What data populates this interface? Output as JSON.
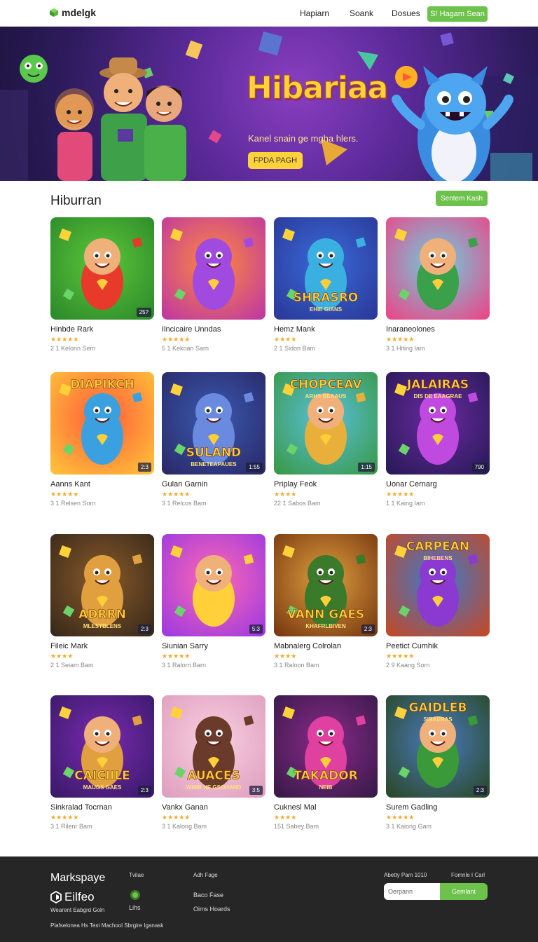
{
  "header": {
    "logo_text": "mdelgk",
    "nav": [
      "Hapiarn",
      "Soank",
      "Dosues"
    ],
    "cta": "S! Hagam Sean"
  },
  "hero": {
    "title": "Hibariaa",
    "subtitle": "Kanel snain ge mgha hlers.",
    "button": "FPDA PAGH"
  },
  "section": {
    "title": "Hiburran",
    "button": "Sentem Kash"
  },
  "cards": [
    {
      "title": "Hinbde Rark",
      "stars": "★★★★★",
      "meta": "2 1 Kelonn Sern",
      "badge": "25?",
      "caption": "",
      "caption_sub": ""
    },
    {
      "title": "Ilncicaire Unndas",
      "stars": "★★★★★",
      "meta": "5 1 Kekoan Sarn",
      "badge": "",
      "caption": "",
      "caption_sub": ""
    },
    {
      "title": "Hemz Mank",
      "stars": "★★★★",
      "meta": "2 1 Sidon Bam",
      "badge": "",
      "caption": "SHRASRO",
      "caption_sub": "EHIE GIANS"
    },
    {
      "title": "Inaraneolones",
      "stars": "★★★★★",
      "meta": "3 1 Hiting Iam",
      "badge": "",
      "caption": "",
      "caption_sub": ""
    },
    {
      "title": "Aanns Kant",
      "stars": "★★★★★",
      "meta": "3 1 Relsen Sorn",
      "badge": "2:3",
      "caption": "DIAPIKCH",
      "caption_sub": ""
    },
    {
      "title": "Gulan Garnin",
      "stars": "★★★★★",
      "meta": "3 1 Relcos Bam",
      "badge": "1:55",
      "caption": "SULAND",
      "caption_sub": "BENETEAPAUES"
    },
    {
      "title": "Priplay Feok",
      "stars": "★★★★",
      "meta": "22 1 Sabos Bam",
      "badge": "1:15",
      "caption": "CHOPCEAV",
      "caption_sub": "ARHS BEAAUS"
    },
    {
      "title": "Uonar Cernarg",
      "stars": "★★★★★",
      "meta": "1 1 Kaing Iam",
      "badge": "790",
      "caption": "JALAIRAS",
      "caption_sub": "DIS DE EAAGRAE"
    },
    {
      "title": "Fileic Mark",
      "stars": "★★★★",
      "meta": "2 1 Seiam Bam",
      "badge": "2:3",
      "caption": "ADRRN",
      "caption_sub": "MLESTBLENS"
    },
    {
      "title": "Siunian Sarry",
      "stars": "★★★★★",
      "meta": "3 1 Ralorn Barn",
      "badge": "5:3",
      "caption": "",
      "caption_sub": ""
    },
    {
      "title": "Mabnalerg Colrolan",
      "stars": "★★★★",
      "meta": "3 1 Raloon Bam",
      "badge": "2:3",
      "caption": "VANN GAES",
      "caption_sub": "KHAFRLBIVEN"
    },
    {
      "title": "Peetict Cumhik",
      "stars": "★★★★★",
      "meta": "2 9 Kaang Sorn",
      "badge": "",
      "caption": "CARPEAN",
      "caption_sub": "BIHEBENS"
    },
    {
      "title": "Sinkralad Tocrnan",
      "stars": "★★★★★",
      "meta": "3 1 Rilenr Bam",
      "badge": "2:3",
      "caption": "CAICIILE",
      "caption_sub": "MAUGS GAES"
    },
    {
      "title": "Vankx Ganan",
      "stars": "★★★★★",
      "meta": "3 1 Kalong Bam",
      "badge": "3:5",
      "caption": "AUACES",
      "caption_sub": "WMIB HE GSOHAND"
    },
    {
      "title": "Cuknesl Mal",
      "stars": "★★★★",
      "meta": "151 Sabey Bam",
      "badge": "",
      "caption": "TAKADOR",
      "caption_sub": "NEIB"
    },
    {
      "title": "Surem Gadling",
      "stars": "★★★★★",
      "meta": "3 1 Kaiong Gam",
      "badge": "2:3",
      "caption": "GAIDLEB",
      "caption_sub": "SIBAERAS"
    }
  ],
  "footer": {
    "brand": "Markspaye",
    "logo_text": "Eilfeo",
    "tagline": "Wearent Eabgrd Goln",
    "copyright": "Plafselonea Hs Test Machool Sbrgire Iganask",
    "col1_title": "Tvilae",
    "col1_link": "Lihs",
    "col2_title": "Adh Fage",
    "col2_links": [
      "Baco Fase",
      "Oims Hoards"
    ],
    "newsletter_label": "Abetty Pam 1010",
    "newsletter_label2": "Fomnle I Carl",
    "input_placeholder": "Oerpann",
    "submit": "Gemlant"
  },
  "colors": {
    "accent": "#6cc24a",
    "footer_bg": "#262626",
    "hero_title": "#ffd23a"
  }
}
